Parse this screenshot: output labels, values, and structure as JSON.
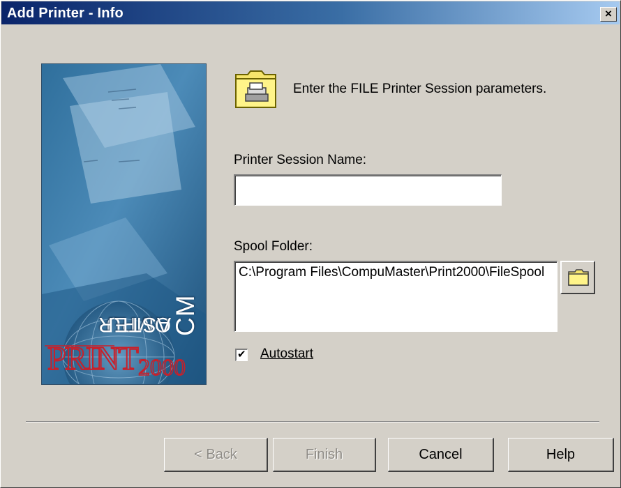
{
  "window": {
    "title": "Add Printer - Info",
    "close_label": "×"
  },
  "banner": {
    "brand": "CompuMaster",
    "logo_text": "PRINT",
    "logo_suffix": "2000"
  },
  "header": {
    "instruction": "Enter the FILE Printer Session parameters."
  },
  "form": {
    "session_name_label": "Printer Session Name:",
    "session_name_value": "",
    "spool_label": "Spool Folder:",
    "spool_value": "C:\\Program Files\\CompuMaster\\Print2000\\FileSpool",
    "autostart_label": "Autostart",
    "autostart_checked": true,
    "check_glyph": "✔"
  },
  "buttons": {
    "back_label": "< Back",
    "back_underline": "B",
    "finish_label": "Finish",
    "cancel_label": "Cancel",
    "help_label": "Help"
  },
  "colors": {
    "titlebar_start": "#0a246a",
    "titlebar_end": "#a6caf0",
    "dialog_bg": "#d4d0c8",
    "banner_blue": "#3f79a8",
    "logo_red": "#c8202a",
    "folder_yellow": "#f6e56c"
  }
}
